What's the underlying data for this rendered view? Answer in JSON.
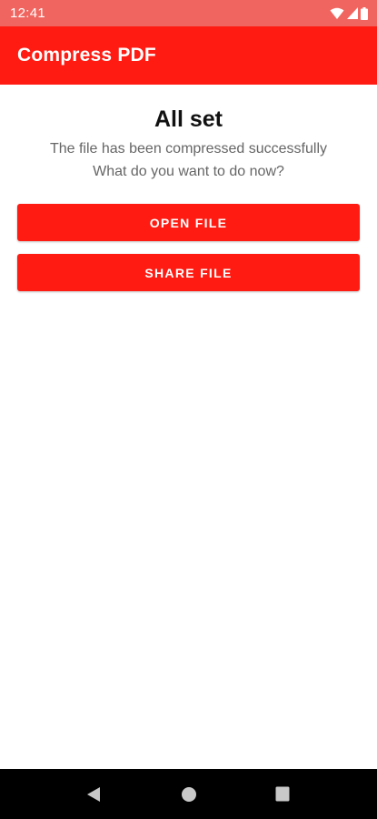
{
  "status_bar": {
    "time": "12:41",
    "icons": [
      "wifi-icon",
      "signal-icon",
      "battery-icon"
    ]
  },
  "app_bar": {
    "title": "Compress PDF"
  },
  "main": {
    "headline": "All set",
    "message_line1": "The file has been compressed successfully",
    "message_line2": "What do you want to do now?",
    "open_button_label": "OPEN FILE",
    "share_button_label": "SHARE FILE"
  },
  "nav_bar": {
    "icons": [
      "back-icon",
      "home-icon",
      "recents-icon"
    ]
  },
  "colors": {
    "accent": "#ff1b12",
    "status_bar": "#f0655f",
    "nav_bar": "#000000"
  }
}
